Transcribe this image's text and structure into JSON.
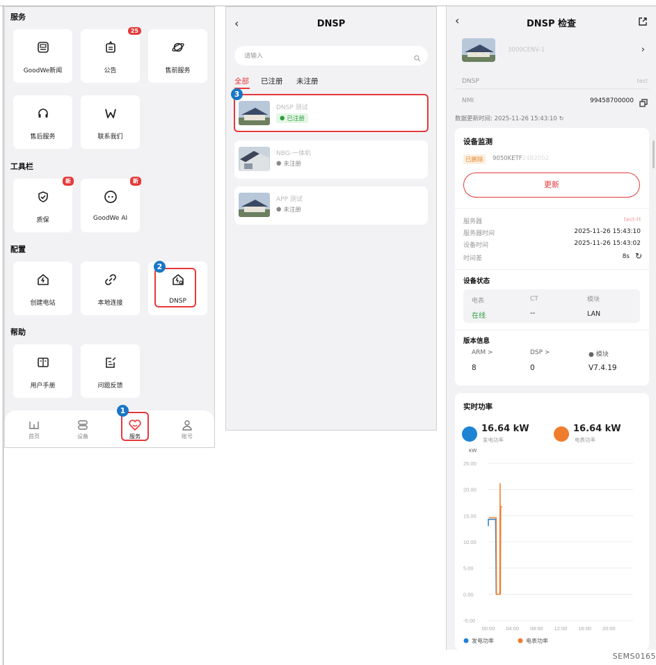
{
  "colors": {
    "accent": "#e53a3a",
    "step_badge": "#1976c7",
    "online": "#2e9d3f",
    "series_gen": "#1f83d4",
    "series_meter": "#f07d2e"
  },
  "panel1": {
    "section_service": "服务",
    "section_tools": "工具栏",
    "section_config": "配置",
    "section_help": "帮助",
    "tiles": {
      "news": "GoodWe新闻",
      "notice": "公告",
      "notice_badge": "25",
      "presale": "售前服务",
      "aftersale": "售后服务",
      "contact": "联系我们",
      "warranty": "质保",
      "warranty_badge": "新",
      "ai": "GoodWe AI",
      "ai_badge": "新",
      "create_plant": "创建电站",
      "local_connect": "本地连接",
      "dnsp": "DNSP",
      "manual": "用户手册",
      "feedback": "问题反馈"
    },
    "tabbar": {
      "home": "首页",
      "devices": "设备",
      "service": "服务",
      "account": "账号"
    },
    "steps": [
      "1",
      "2"
    ]
  },
  "panel2": {
    "title": "DNSP",
    "back_icon": "chevron-left-icon",
    "search_placeholder": "请输入",
    "tabs": [
      "全部",
      "已注册",
      "未注册"
    ],
    "step": "3",
    "sites": [
      {
        "name": "DNSP 测试",
        "status": "已注册"
      },
      {
        "name": "NBG-一体机",
        "status": "未注册"
      },
      {
        "name": "APP 测试",
        "status": "未注册"
      }
    ]
  },
  "panel3": {
    "title": "DNSP 检查",
    "device_name": "3000CENV-1",
    "dnsp_label": "DNSP",
    "dnsp_value": "test",
    "nmi_label": "NMI",
    "nmi_value": "99458700000",
    "update_time": "数据更新时间: 2025-11-26 15:43:10",
    "monitor_title": "设备监测",
    "deleted_tag": "已删除",
    "device_sn": "9050KETF",
    "device_sn_blur": "24B2002",
    "update_button": "更新",
    "server_label": "服务器",
    "server_value": "test-H",
    "server_time_label": "服务器时间",
    "server_time_value": "2025-11-26 15:43:10",
    "device_time_label": "设备时间",
    "device_time_value": "2025-11-26 15:43:02",
    "time_diff_label": "时间差",
    "time_diff_value": "8s",
    "status_title": "设备状态",
    "status_headers": [
      "电表",
      "CT",
      "模块"
    ],
    "status_values": [
      "在线",
      "--",
      "LAN"
    ],
    "version_title": "版本信息",
    "version_headers": [
      "ARM >",
      "DSP >",
      "模块"
    ],
    "version_values": [
      "8",
      "0",
      "V7.4.19"
    ],
    "power_title": "实时功率",
    "gen_power": "16.64 kW",
    "gen_label": "发电功率",
    "meter_power": "16.64 kW",
    "meter_label": "电表功率"
  },
  "chart_data": {
    "type": "line",
    "ylabel": "kW",
    "ylim": [
      -5,
      25
    ],
    "yticks": [
      "25.00",
      "20.00",
      "15.00",
      "10.00",
      "5.00",
      "0.00",
      "-5.00"
    ],
    "xticks": [
      "00:00",
      "04:00",
      "08:00",
      "12:00",
      "16:00",
      "20:00"
    ],
    "series": [
      {
        "name": "发电功率",
        "points": [
          [
            0.0,
            13.0
          ],
          [
            0.0,
            14.3
          ],
          [
            1.2,
            14.3
          ],
          [
            1.3,
            0.0
          ]
        ]
      },
      {
        "name": "电表功率",
        "points": [
          [
            0.05,
            14.6
          ],
          [
            1.3,
            14.6
          ],
          [
            1.35,
            0.0
          ],
          [
            1.9,
            0.0
          ],
          [
            1.95,
            21.2
          ],
          [
            2.0,
            0.0
          ],
          [
            2.05,
            16.7
          ],
          [
            2.3,
            16.7
          ]
        ]
      }
    ],
    "legend": "bottom-left"
  },
  "footer_code": "SEMS0165"
}
